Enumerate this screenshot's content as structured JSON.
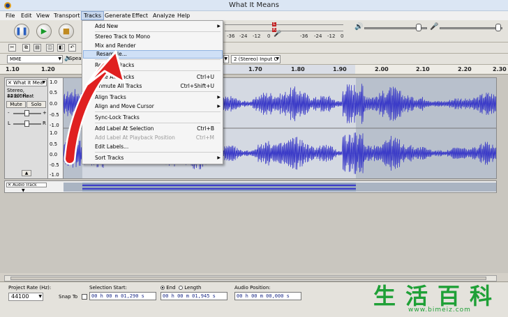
{
  "window": {
    "title": "What It Means"
  },
  "menubar": {
    "items": [
      "File",
      "Edit",
      "View",
      "Transport",
      "Tracks",
      "Generate",
      "Effect",
      "Analyze",
      "Help"
    ],
    "active": "Tracks"
  },
  "tracks_menu": {
    "add_new": "Add New",
    "stereo_to_mono": "Stereo Track to Mono",
    "mix_and_render": "Mix and Render",
    "resample": "Resample...",
    "remove_tracks": "Remove Tracks",
    "mute_all": "Mute All Tracks",
    "mute_all_shortcut": "Ctrl+U",
    "unmute_all": "Unmute All Tracks",
    "unmute_all_shortcut": "Ctrl+Shift+U",
    "align_tracks": "Align Tracks",
    "align_move_cursor": "Align and Move Cursor",
    "sync_lock": "Sync-Lock Tracks",
    "add_label_selection": "Add Label At Selection",
    "add_label_selection_shortcut": "Ctrl+B",
    "add_label_playback": "Add Label At Playback Position",
    "add_label_playback_shortcut": "Ctrl+M",
    "edit_labels": "Edit Labels...",
    "sort_tracks": "Sort Tracks"
  },
  "meters": {
    "labels": [
      "-36",
      "-24",
      "-12",
      "0",
      "-36",
      "-24",
      "-12",
      "0"
    ],
    "l": "L",
    "r": "R"
  },
  "device": {
    "host": "MME",
    "playback_prefix": "Spea",
    "channels": "2 (Stereo) Input C"
  },
  "ruler": {
    "ticks": [
      "1.10",
      "1.20",
      "1.70",
      "1.80",
      "1.90",
      "2.00",
      "2.10",
      "2.20",
      "2.30"
    ]
  },
  "track1": {
    "name": "What It Mea",
    "rate": "Stereo, 44100Hz",
    "format": "32-bit float",
    "mute": "Mute",
    "solo": "Solo",
    "gain_minus": "-",
    "gain_plus": "+",
    "pan_l": "L",
    "pan_r": "R",
    "scale_top": [
      "1.0",
      "0.5",
      "0.0",
      "-0.5",
      "-1.0"
    ],
    "scale_bottom": [
      "1.0",
      "0.5",
      "0.0",
      "-0.5",
      "-1.0"
    ]
  },
  "track2": {
    "name": "Audio Track"
  },
  "selection_bar": {
    "project_rate_label": "Project Rate (Hz):",
    "project_rate_value": "44100",
    "snap_to": "Snap To",
    "selection_start_label": "Selection Start:",
    "selection_start": "00 h 00 m 01,290 s",
    "end_label": "End",
    "length_label": "Length",
    "selection_end": "00 h 00 m 01,945 s",
    "audio_position_label": "Audio Position:",
    "audio_position": "00 h 00 m 00,000 s"
  },
  "watermark": {
    "glyphs": "生活百科",
    "url": "www.bimeiz.com"
  },
  "colors": {
    "waveform": "#3c3cc8",
    "selection": "#aab4c2",
    "arrow": "#e02020"
  }
}
